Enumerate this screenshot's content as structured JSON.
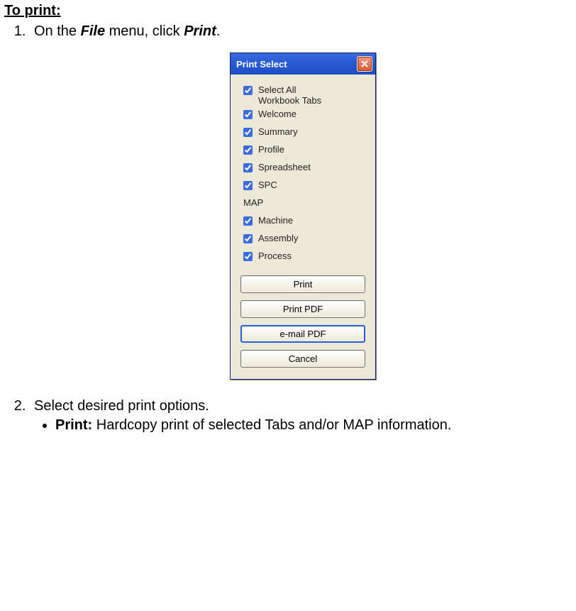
{
  "doc": {
    "section_title": "To print:",
    "step1_prefix": "On the ",
    "step1_menu": "File",
    "step1_mid": " menu, click ",
    "step1_action": "Print",
    "step1_suffix": ".",
    "step2": "Select desired print options.",
    "bullet1_label": "Print:",
    "bullet1_text": " Hardcopy print of selected Tabs and/or MAP information."
  },
  "dialog": {
    "title": "Print Select",
    "close_icon": "close-icon",
    "workbook_group": "Workbook Tabs",
    "map_group": "MAP",
    "checkboxes": {
      "select_all": "Select All",
      "welcome": "Welcome",
      "summary": "Summary",
      "profile": "Profile",
      "spreadsheet": "Spreadsheet",
      "spc": "SPC",
      "machine": "Machine",
      "assembly": "Assembly",
      "process": "Process"
    },
    "buttons": {
      "print": "Print",
      "print_pdf": "Print PDF",
      "email_pdf": "e-mail PDF",
      "cancel": "Cancel"
    }
  }
}
